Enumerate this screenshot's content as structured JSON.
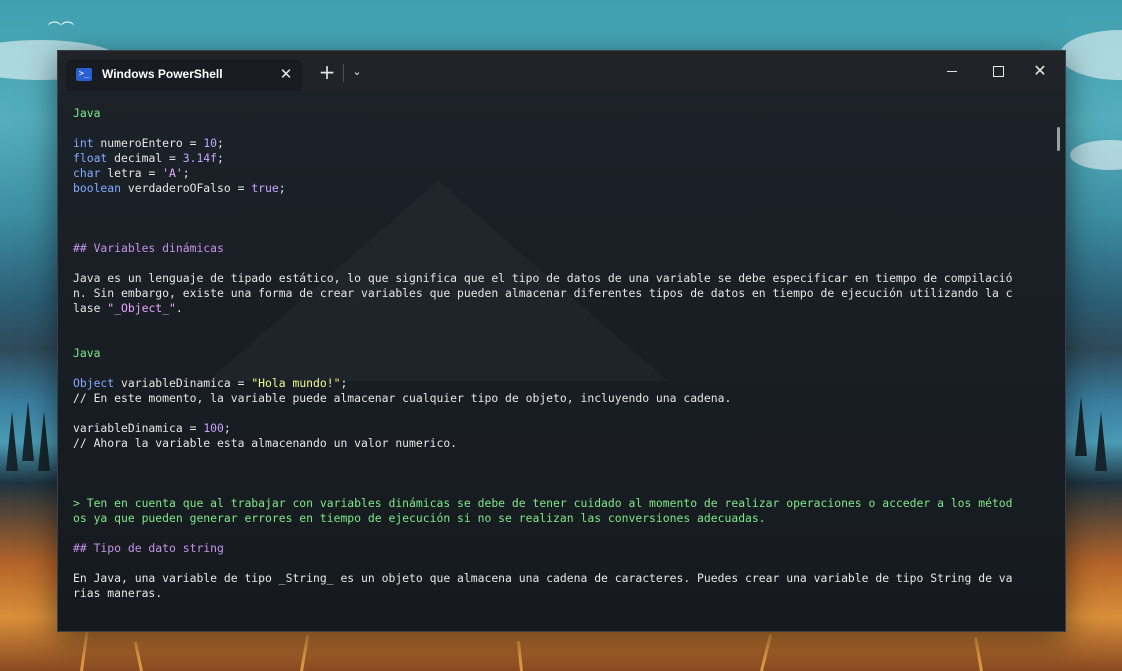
{
  "window": {
    "tab_title": "Windows PowerShell",
    "tab_icon": "powershell-icon",
    "tab_close": "✕",
    "new_tab": "+",
    "dropdown": "⌄",
    "close": "✕"
  },
  "terminal": {
    "l01": "Java",
    "l02": {
      "kw": "int",
      "rest": " numeroEntero = ",
      "val": "10",
      "end": ";"
    },
    "l03": {
      "kw": "float",
      "rest": " decimal = ",
      "val": "3.14f",
      "end": ";"
    },
    "l04": {
      "kw": "char",
      "rest": " letra = ",
      "val": "'A'",
      "end": ";"
    },
    "l05": {
      "kw": "boolean",
      "rest": " verdaderoOFalso = ",
      "val": "true",
      "end": ";"
    },
    "l06": "## Variables dinámicas",
    "l07": "Java es un lenguaje de tipado estático, lo que significa que el tipo de datos de una variable se debe especificar en tiempo de compilació",
    "l08": "n. Sin embargo, existe una forma de crear variables que pueden almacenar diferentes tipos de datos en tiempo de ejecución utilizando la c",
    "l09": {
      "pre": "lase ",
      "q": "\"_Object_\"",
      "post": "."
    },
    "l10": "Java",
    "l11": {
      "kw": "Object",
      "rest": " variableDinamica = ",
      "val": "\"Hola mundo!\"",
      "end": ";"
    },
    "l12": "// En este momento, la variable puede almacenar cualquier tipo de objeto, incluyendo una cadena.",
    "l13": {
      "pre": "variableDinamica = ",
      "val": "100",
      "end": ";"
    },
    "l14": "// Ahora la variable esta almacenando un valor numerico.",
    "l15": "> Ten en cuenta que al trabajar con variables dinámicas se debe de tener cuidado al momento de realizar operaciones o acceder a los métod",
    "l16": "os ya que pueden generar errores en tiempo de ejecución si no se realizan las conversiones adecuadas.",
    "l17": "## Tipo de dato string",
    "l18": "En Java, una variable de tipo _String_ es un objeto que almacena una cadena de caracteres. Puedes crear una variable de tipo String de va",
    "l19": "rias maneras."
  }
}
